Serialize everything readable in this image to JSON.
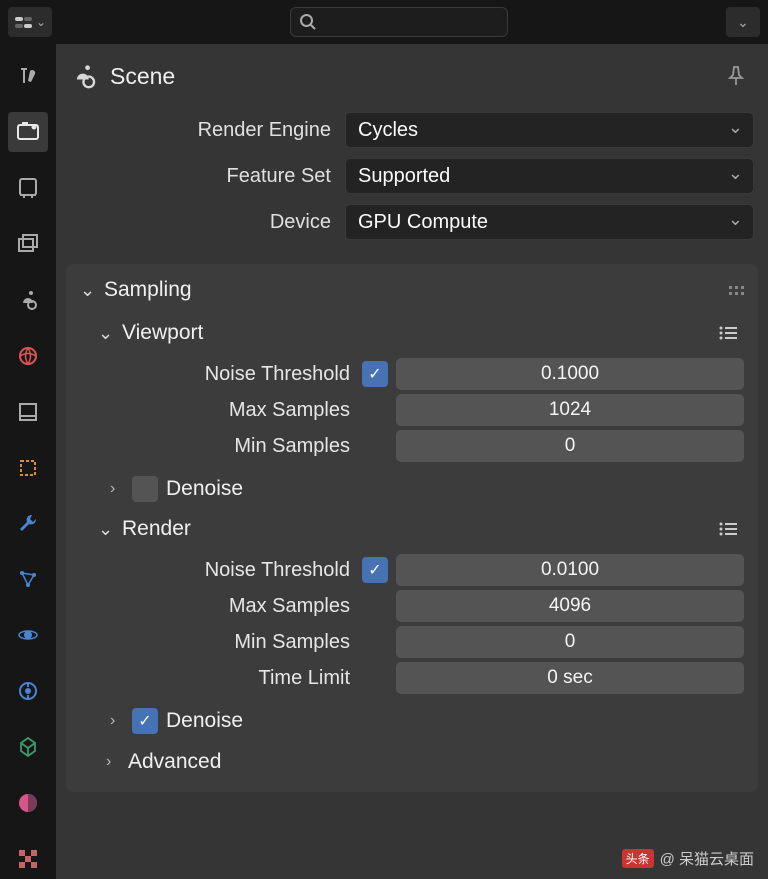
{
  "header": {
    "title": "Scene"
  },
  "props": {
    "render_engine": {
      "label": "Render Engine",
      "value": "Cycles"
    },
    "feature_set": {
      "label": "Feature Set",
      "value": "Supported"
    },
    "device": {
      "label": "Device",
      "value": "GPU Compute"
    }
  },
  "sampling": {
    "title": "Sampling",
    "viewport": {
      "title": "Viewport",
      "noise_threshold": {
        "label": "Noise Threshold",
        "checked": true,
        "value": "0.1000"
      },
      "max_samples": {
        "label": "Max Samples",
        "value": "1024"
      },
      "min_samples": {
        "label": "Min Samples",
        "value": "0"
      },
      "denoise": {
        "label": "Denoise",
        "checked": false
      }
    },
    "render": {
      "title": "Render",
      "noise_threshold": {
        "label": "Noise Threshold",
        "checked": true,
        "value": "0.0100"
      },
      "max_samples": {
        "label": "Max Samples",
        "value": "4096"
      },
      "min_samples": {
        "label": "Min Samples",
        "value": "0"
      },
      "time_limit": {
        "label": "Time Limit",
        "value": "0 sec"
      },
      "denoise": {
        "label": "Denoise",
        "checked": true
      }
    },
    "advanced": {
      "title": "Advanced"
    }
  },
  "sidebar": {
    "tabs": [
      "tool",
      "render",
      "output",
      "view-layer",
      "scene",
      "world",
      "object",
      "modifier",
      "particles",
      "physics",
      "constraints",
      "data",
      "material",
      "texture"
    ]
  },
  "watermark": {
    "label": "头条",
    "text": "@ 呆猫云桌面"
  }
}
